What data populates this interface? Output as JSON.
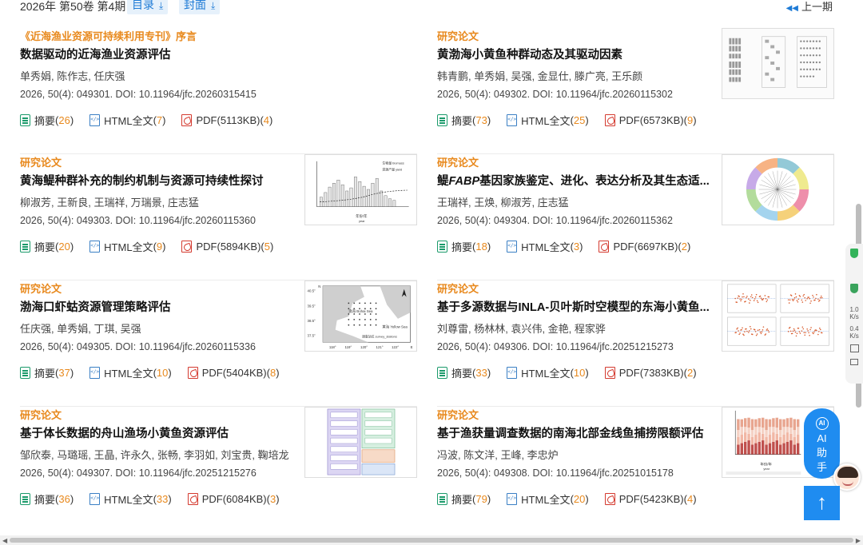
{
  "header": {
    "issue": "2026年 第50卷 第4期",
    "toc_label": "目录",
    "cover_label": "封面",
    "prev_label": "上一期"
  },
  "articles": [
    {
      "category": "《近海渔业资源可持续利用专刊》序言",
      "title": "数据驱动的近海渔业资源评估",
      "authors": "单秀娟, 陈作志, 任庆强",
      "citation": "2026, 50(4): 049301. DOI: 10.11964/jfc.20260315415",
      "abstract_label": "摘要",
      "abstract_count": "26",
      "html_label": "HTML全文",
      "html_count": "7",
      "pdf_label": "PDF(5113KB)",
      "pdf_count": "4",
      "has_thumb": false
    },
    {
      "category": "研究论文",
      "title": "黄渤海小黄鱼种群动态及其驱动因素",
      "authors": "韩青鹏, 单秀娟, 吴强, 金显仕, 滕广亮, 王乐颜",
      "citation": "2026, 50(4): 049302. DOI: 10.11964/jfc.20260115302",
      "abstract_label": "摘要",
      "abstract_count": "73",
      "html_label": "HTML全文",
      "html_count": "25",
      "pdf_label": "PDF(6573KB)",
      "pdf_count": "9",
      "has_thumb": true,
      "thumb_icon": "histogram-grid-figure"
    },
    {
      "category": "研究论文",
      "title": "黄海鳀种群补充的制约机制与资源可持续性探讨",
      "authors": "柳淑芳, 王新良, 王瑞祥, 万瑞景, 庄志猛",
      "citation": "2026, 50(4): 049303. DOI: 10.11964/jfc.20260115360",
      "abstract_label": "摘要",
      "abstract_count": "20",
      "html_label": "HTML全文",
      "html_count": "9",
      "pdf_label": "PDF(5894KB)",
      "pdf_count": "5",
      "has_thumb": true,
      "thumb_icon": "bar-line-chart-figure",
      "thumb_text": {
        "xlabel_cn": "年份/年",
        "xlabel_en": "year",
        "legend1": "生物量 biomass",
        "legend2": "资源产量 yield"
      }
    },
    {
      "category": "研究论文",
      "title": "鳀FABP基因家族鉴定、进化、表达分析及其生态适...",
      "authors": "王瑞祥, 王焕, 柳淑芳, 庄志猛",
      "citation": "2026, 50(4): 049304. DOI: 10.11964/jfc.20260115362",
      "abstract_label": "摘要",
      "abstract_count": "18",
      "html_label": "HTML全文",
      "html_count": "3",
      "pdf_label": "PDF(6697KB)",
      "pdf_count": "2",
      "has_thumb": true,
      "thumb_icon": "circular-phylogenetic-tree-figure"
    },
    {
      "category": "研究论文",
      "title": "渤海口虾蛄资源管理策略评估",
      "authors": "任庆强, 单秀娟, 丁琪, 吴强",
      "citation": "2026, 50(4): 049305. DOI: 10.11964/jfc.20260115336",
      "abstract_label": "摘要",
      "abstract_count": "37",
      "html_label": "HTML全文",
      "html_count": "10",
      "pdf_label": "PDF(5404KB)",
      "pdf_count": "8",
      "has_thumb": true,
      "thumb_icon": "sea-map-figure",
      "thumb_text": {
        "bohai": "渤海 Bohai Sea",
        "yellow": "黄海 Yellow Sea",
        "survey": "调查站位 survey_stations",
        "lat1": "40.5°",
        "lat2": "39.5°",
        "lat3": "38.5°",
        "lat4": "37.5°",
        "lon1": "118°",
        "lon2": "119°",
        "lon3": "120°",
        "lon4": "121°",
        "lon5": "122°",
        "e": "E",
        "n": "N"
      }
    },
    {
      "category": "研究论文",
      "title": "基于多源数据与INLA-贝叶斯时空模型的东海小黄鱼...",
      "authors": "刘尊雷, 杨林林, 袁兴伟, 金艳, 程家骅",
      "citation": "2026, 50(4): 049306. DOI: 10.11964/jfc.20251215273",
      "abstract_label": "摘要",
      "abstract_count": "33",
      "html_label": "HTML全文",
      "html_count": "10",
      "pdf_label": "PDF(7383KB)",
      "pdf_count": "2",
      "has_thumb": true,
      "thumb_icon": "scatter-panels-figure"
    },
    {
      "category": "研究论文",
      "title": "基于体长数据的舟山渔场小黄鱼资源评估",
      "authors": "邹欣泰, 马璐瑶, 王晶, 许永久, 张畅, 李羽如, 刘宝贵, 鞠培龙",
      "citation": "2026, 50(4): 049307. DOI: 10.11964/jfc.20251215276",
      "abstract_label": "摘要",
      "abstract_count": "36",
      "html_label": "HTML全文",
      "html_count": "33",
      "pdf_label": "PDF(6084KB)",
      "pdf_count": "3",
      "has_thumb": true,
      "thumb_icon": "flowchart-figure"
    },
    {
      "category": "研究论文",
      "title": "基于渔获量调查数据的南海北部金线鱼捕捞限额评估",
      "authors": "冯波, 陈文洋, 王峰, 李忠炉",
      "citation": "2026, 50(4): 049308. DOI: 10.11964/jfc.20251015178",
      "abstract_label": "摘要",
      "abstract_count": "79",
      "html_label": "HTML全文",
      "html_count": "20",
      "pdf_label": "PDF(5423KB)",
      "pdf_count": "4",
      "has_thumb": true,
      "thumb_icon": "stacked-bar-figure",
      "thumb_text": {
        "xlabel_cn": "年份/年",
        "xlabel_en": "year"
      }
    }
  ],
  "widgets": {
    "ai_assistant": "AI助手",
    "ai_mark": "AI",
    "speed_up": "1.0",
    "speed_down": "0.4",
    "speed_unit": "K/s",
    "back_to_top_icon": "arrow-up-icon"
  },
  "colors": {
    "accent": "#1e7bd6",
    "category": "#e8891d",
    "count": "#e8891d",
    "ai_blue": "#1f8cf0"
  }
}
